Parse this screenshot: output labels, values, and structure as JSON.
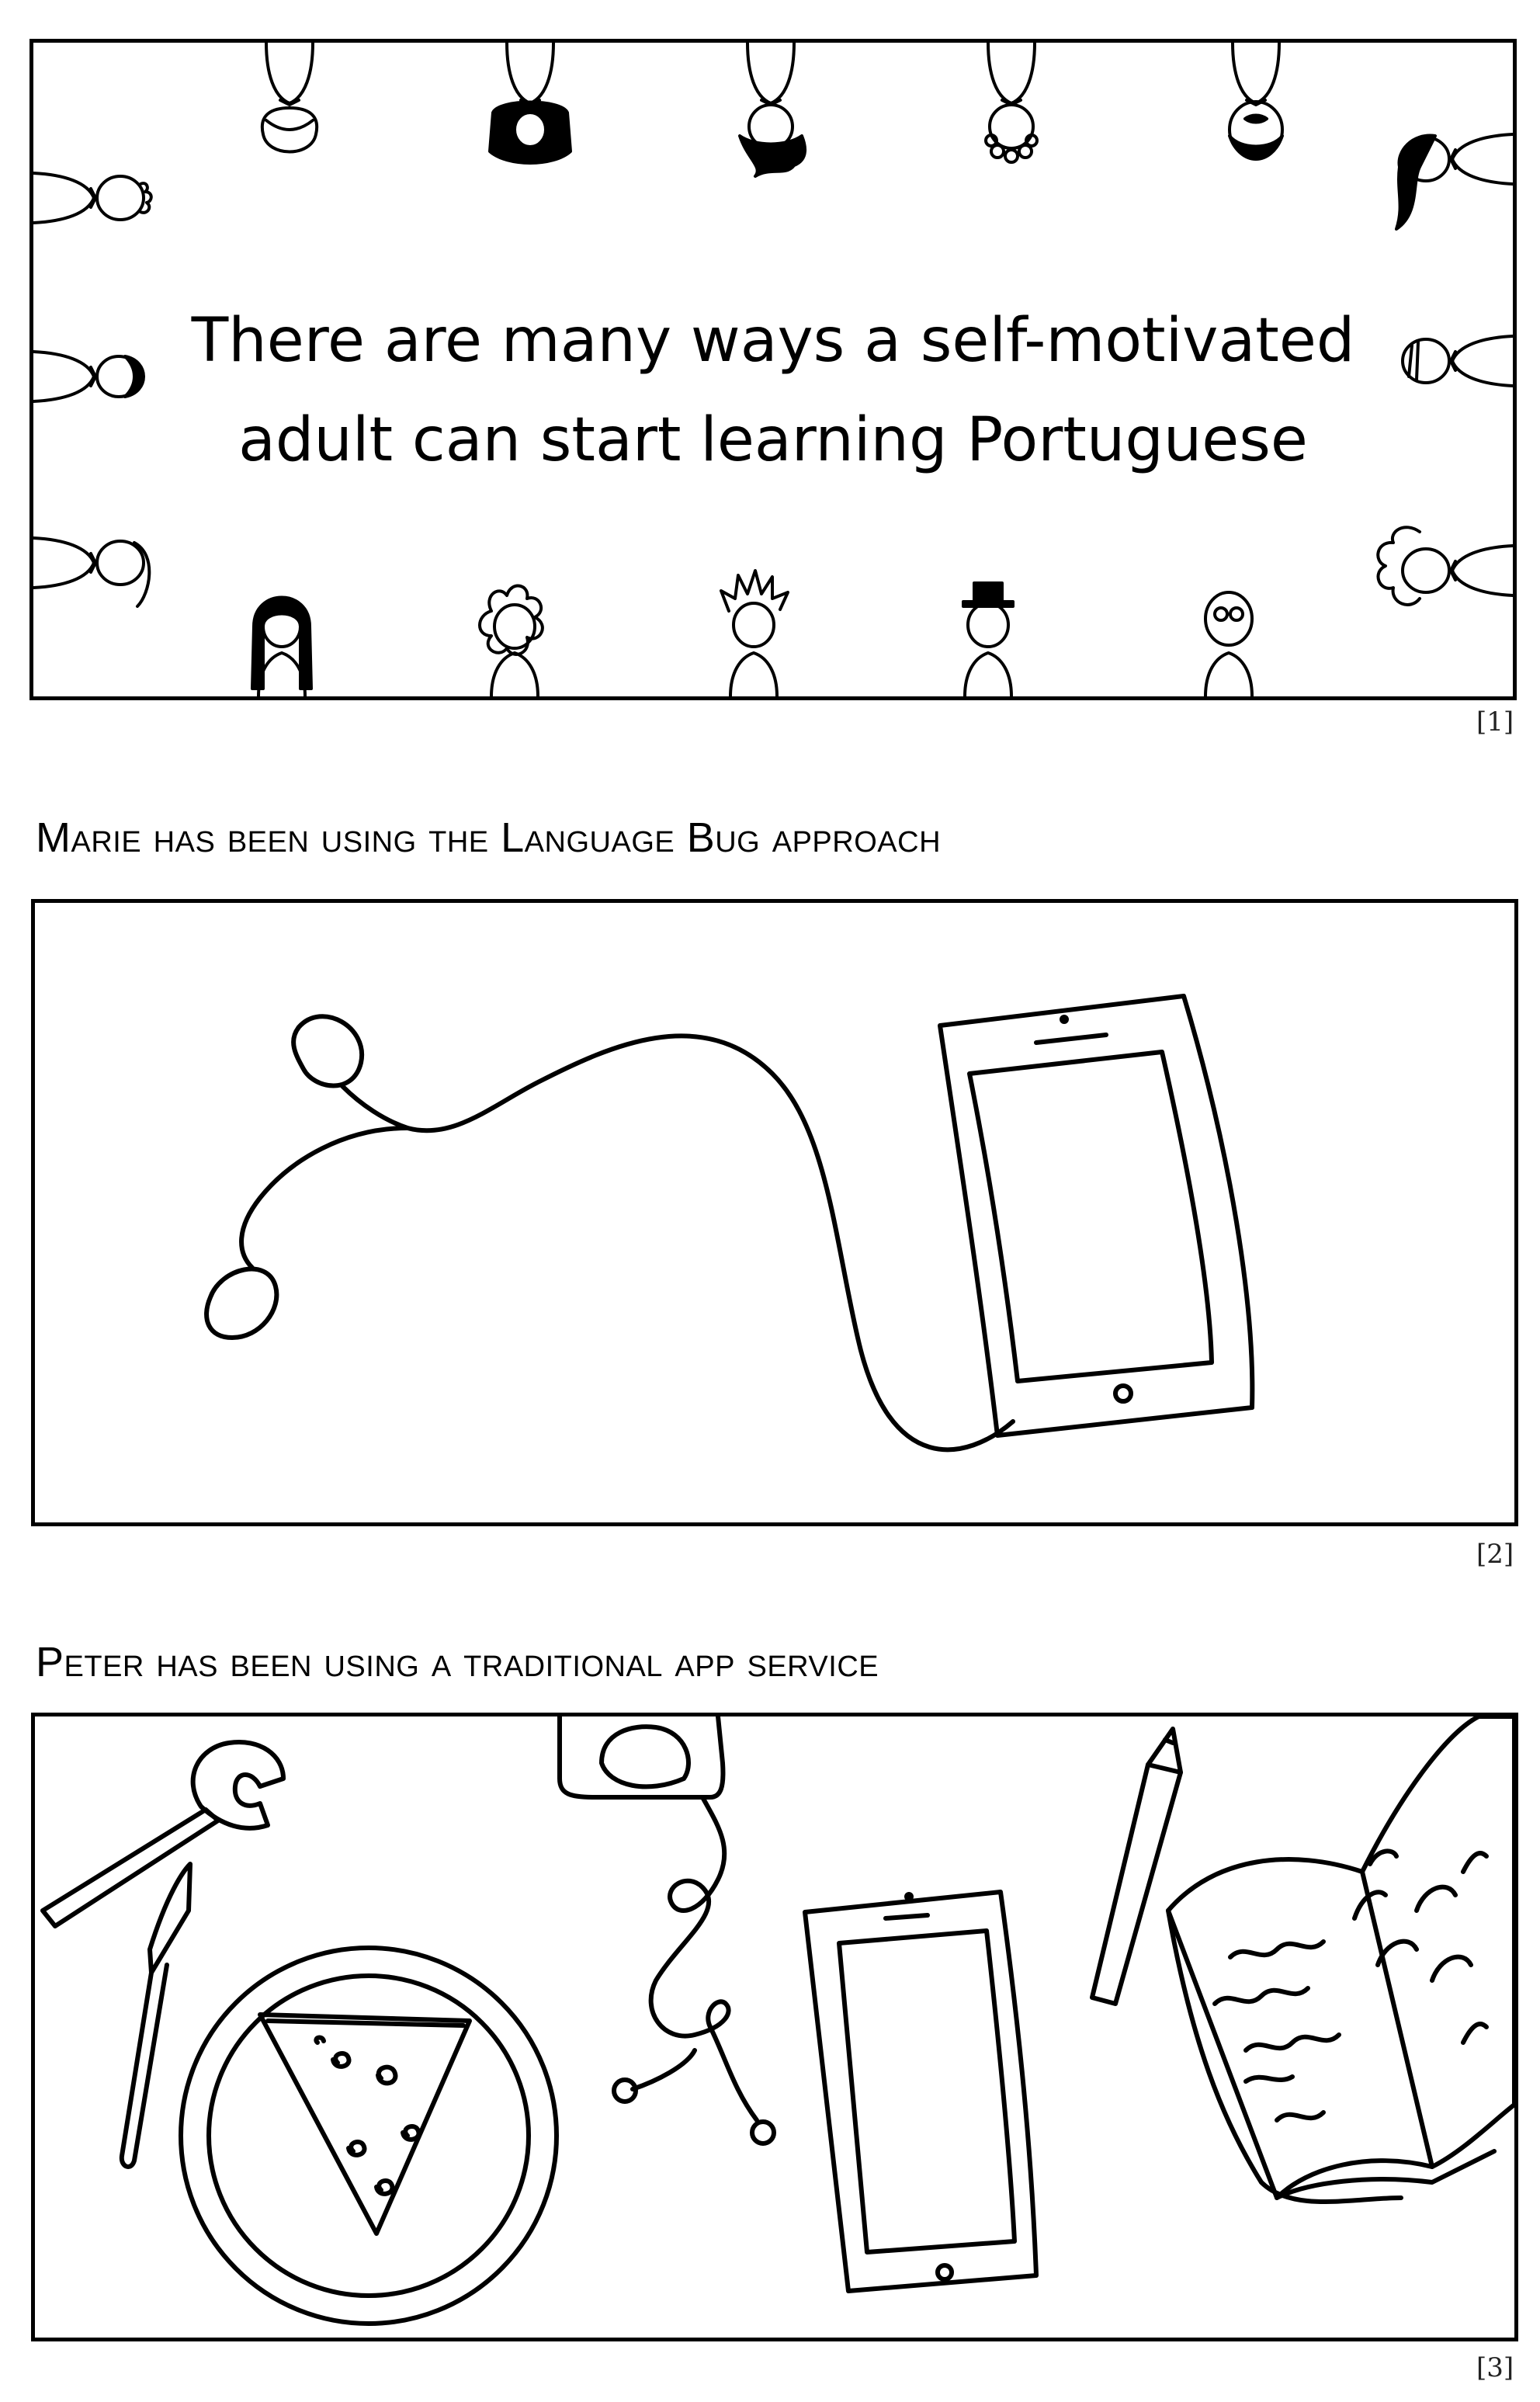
{
  "panels": [
    {
      "number": "[1]",
      "headline": [
        "There are many ways a self-motivated",
        "adult can start learning Portuguese"
      ],
      "illustration": "ring of people looking in toward the center"
    },
    {
      "number": "[2]",
      "caption": "Marie has been using the Language Bug approach",
      "illustration": "earphones plugged into a tablet"
    },
    {
      "number": "[3]",
      "caption": "Peter has been using a traditional app service",
      "illustration": "desk with plate of pizza, fork, knife, tablet with earphones, pencil and open book"
    }
  ]
}
